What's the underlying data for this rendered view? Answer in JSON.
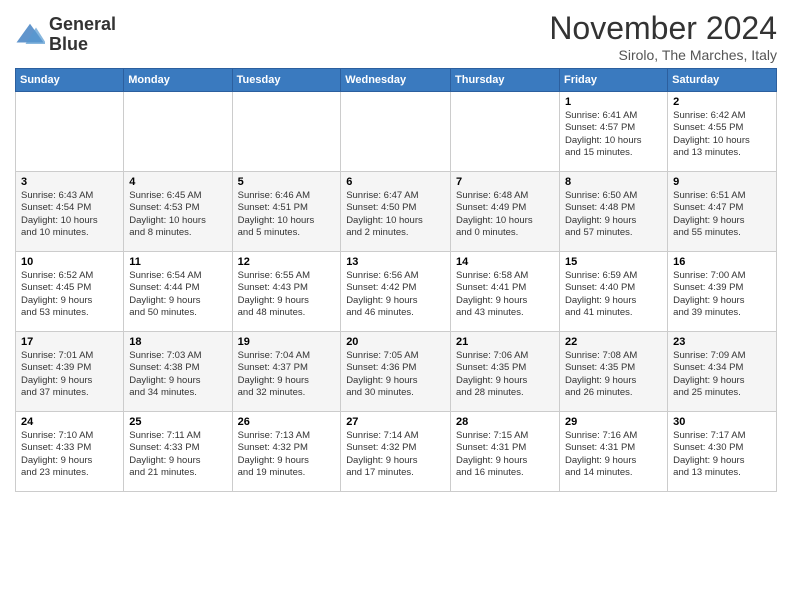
{
  "header": {
    "logo_line1": "General",
    "logo_line2": "Blue",
    "month_title": "November 2024",
    "location": "Sirolo, The Marches, Italy"
  },
  "weekdays": [
    "Sunday",
    "Monday",
    "Tuesday",
    "Wednesday",
    "Thursday",
    "Friday",
    "Saturday"
  ],
  "weeks": [
    [
      {
        "day": "",
        "info": ""
      },
      {
        "day": "",
        "info": ""
      },
      {
        "day": "",
        "info": ""
      },
      {
        "day": "",
        "info": ""
      },
      {
        "day": "",
        "info": ""
      },
      {
        "day": "1",
        "info": "Sunrise: 6:41 AM\nSunset: 4:57 PM\nDaylight: 10 hours\nand 15 minutes."
      },
      {
        "day": "2",
        "info": "Sunrise: 6:42 AM\nSunset: 4:55 PM\nDaylight: 10 hours\nand 13 minutes."
      }
    ],
    [
      {
        "day": "3",
        "info": "Sunrise: 6:43 AM\nSunset: 4:54 PM\nDaylight: 10 hours\nand 10 minutes."
      },
      {
        "day": "4",
        "info": "Sunrise: 6:45 AM\nSunset: 4:53 PM\nDaylight: 10 hours\nand 8 minutes."
      },
      {
        "day": "5",
        "info": "Sunrise: 6:46 AM\nSunset: 4:51 PM\nDaylight: 10 hours\nand 5 minutes."
      },
      {
        "day": "6",
        "info": "Sunrise: 6:47 AM\nSunset: 4:50 PM\nDaylight: 10 hours\nand 2 minutes."
      },
      {
        "day": "7",
        "info": "Sunrise: 6:48 AM\nSunset: 4:49 PM\nDaylight: 10 hours\nand 0 minutes."
      },
      {
        "day": "8",
        "info": "Sunrise: 6:50 AM\nSunset: 4:48 PM\nDaylight: 9 hours\nand 57 minutes."
      },
      {
        "day": "9",
        "info": "Sunrise: 6:51 AM\nSunset: 4:47 PM\nDaylight: 9 hours\nand 55 minutes."
      }
    ],
    [
      {
        "day": "10",
        "info": "Sunrise: 6:52 AM\nSunset: 4:45 PM\nDaylight: 9 hours\nand 53 minutes."
      },
      {
        "day": "11",
        "info": "Sunrise: 6:54 AM\nSunset: 4:44 PM\nDaylight: 9 hours\nand 50 minutes."
      },
      {
        "day": "12",
        "info": "Sunrise: 6:55 AM\nSunset: 4:43 PM\nDaylight: 9 hours\nand 48 minutes."
      },
      {
        "day": "13",
        "info": "Sunrise: 6:56 AM\nSunset: 4:42 PM\nDaylight: 9 hours\nand 46 minutes."
      },
      {
        "day": "14",
        "info": "Sunrise: 6:58 AM\nSunset: 4:41 PM\nDaylight: 9 hours\nand 43 minutes."
      },
      {
        "day": "15",
        "info": "Sunrise: 6:59 AM\nSunset: 4:40 PM\nDaylight: 9 hours\nand 41 minutes."
      },
      {
        "day": "16",
        "info": "Sunrise: 7:00 AM\nSunset: 4:39 PM\nDaylight: 9 hours\nand 39 minutes."
      }
    ],
    [
      {
        "day": "17",
        "info": "Sunrise: 7:01 AM\nSunset: 4:39 PM\nDaylight: 9 hours\nand 37 minutes."
      },
      {
        "day": "18",
        "info": "Sunrise: 7:03 AM\nSunset: 4:38 PM\nDaylight: 9 hours\nand 34 minutes."
      },
      {
        "day": "19",
        "info": "Sunrise: 7:04 AM\nSunset: 4:37 PM\nDaylight: 9 hours\nand 32 minutes."
      },
      {
        "day": "20",
        "info": "Sunrise: 7:05 AM\nSunset: 4:36 PM\nDaylight: 9 hours\nand 30 minutes."
      },
      {
        "day": "21",
        "info": "Sunrise: 7:06 AM\nSunset: 4:35 PM\nDaylight: 9 hours\nand 28 minutes."
      },
      {
        "day": "22",
        "info": "Sunrise: 7:08 AM\nSunset: 4:35 PM\nDaylight: 9 hours\nand 26 minutes."
      },
      {
        "day": "23",
        "info": "Sunrise: 7:09 AM\nSunset: 4:34 PM\nDaylight: 9 hours\nand 25 minutes."
      }
    ],
    [
      {
        "day": "24",
        "info": "Sunrise: 7:10 AM\nSunset: 4:33 PM\nDaylight: 9 hours\nand 23 minutes."
      },
      {
        "day": "25",
        "info": "Sunrise: 7:11 AM\nSunset: 4:33 PM\nDaylight: 9 hours\nand 21 minutes."
      },
      {
        "day": "26",
        "info": "Sunrise: 7:13 AM\nSunset: 4:32 PM\nDaylight: 9 hours\nand 19 minutes."
      },
      {
        "day": "27",
        "info": "Sunrise: 7:14 AM\nSunset: 4:32 PM\nDaylight: 9 hours\nand 17 minutes."
      },
      {
        "day": "28",
        "info": "Sunrise: 7:15 AM\nSunset: 4:31 PM\nDaylight: 9 hours\nand 16 minutes."
      },
      {
        "day": "29",
        "info": "Sunrise: 7:16 AM\nSunset: 4:31 PM\nDaylight: 9 hours\nand 14 minutes."
      },
      {
        "day": "30",
        "info": "Sunrise: 7:17 AM\nSunset: 4:30 PM\nDaylight: 9 hours\nand 13 minutes."
      }
    ]
  ]
}
